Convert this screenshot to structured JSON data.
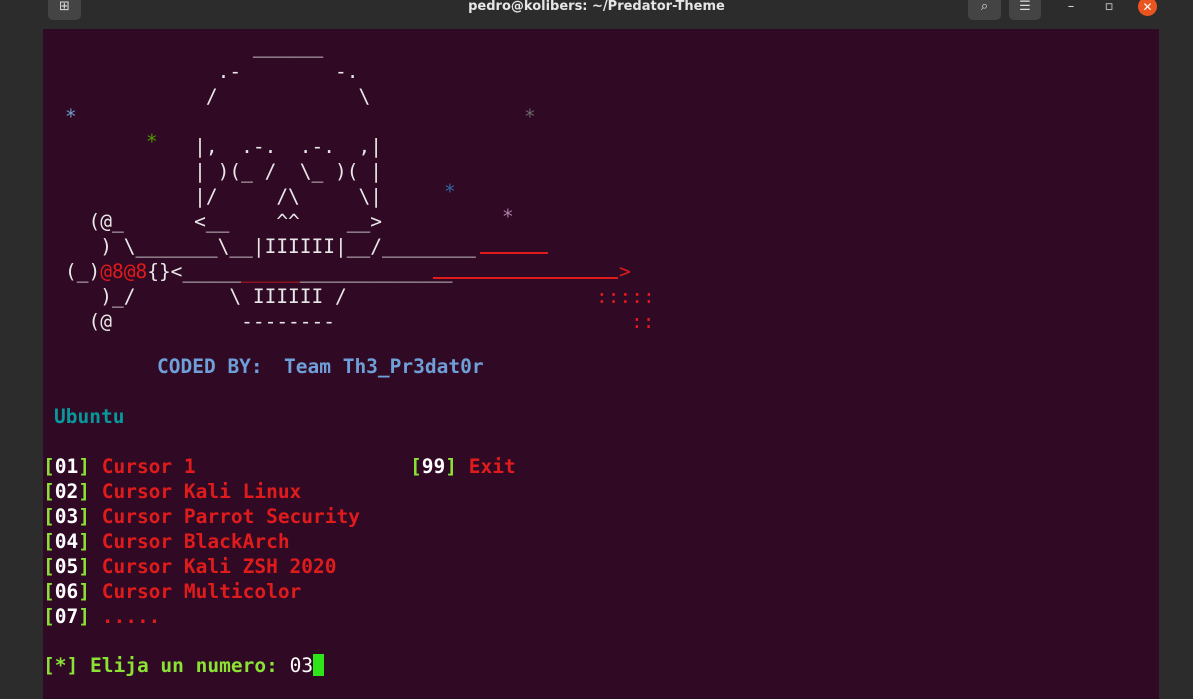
{
  "window": {
    "title": "pedro@kolibers: ~/Predator-Theme",
    "icons": {
      "new_tab": "new-tab-icon",
      "search": "search-icon",
      "menu": "hamburger-menu-icon",
      "minimize": "minimize-icon",
      "maximize": "maximize-icon",
      "close": "close-icon"
    },
    "glyphs": {
      "new_tab": "⊞",
      "search": "⌕",
      "menu": "☰",
      "minimize": "–",
      "maximize": "▫",
      "close": "✕"
    }
  },
  "banner": {
    "art_lines": [
      "                ______",
      "             .-        -.",
      "            /            \\",
      "",
      "           |,  .-.  .-.  ,|",
      "           | )(_ /  \\_ )( |",
      "           |/     /\\     \\|",
      "  (@_      <__    ^^    __>",
      "   ) \\_______\\__|IIIIII|__/________",
      "(_)",
      "   )_/        \\ IIIIII /",
      "  (@           --------"
    ],
    "skull_line_red": "@8@8",
    "skull_line_mid": "{}<",
    "skull_line_under": "_____",
    "skull_line_under2": "_____________",
    "arrow_tip": ">",
    "dots_1": ":::::",
    "dots_2": "::",
    "stars": [
      "*",
      "*",
      "*",
      "*",
      "*"
    ],
    "star_colors": [
      "#729fcf",
      "#4e9a06",
      "#6a6a6a",
      "#3465a4",
      "#ad7fa8"
    ],
    "coded_by_label": "CODED BY:",
    "coded_by_team": "Team Th3_Pr3dat0r"
  },
  "os_label": "Ubuntu",
  "menu": {
    "items": [
      {
        "num": "01",
        "label": "Cursor 1"
      },
      {
        "num": "02",
        "label": "Cursor Kali Linux"
      },
      {
        "num": "03",
        "label": "Cursor Parrot Security"
      },
      {
        "num": "04",
        "label": "Cursor BlackArch"
      },
      {
        "num": "05",
        "label": "Cursor Kali ZSH 2020"
      },
      {
        "num": "06",
        "label": "Cursor Multicolor"
      },
      {
        "num": "07",
        "label": "....."
      }
    ],
    "exit": {
      "num": "99",
      "label": "Exit"
    }
  },
  "prompt": {
    "marker": "[*]",
    "text": "Elija un numero:",
    "input": "03"
  },
  "colors": {
    "terminal_bg": "#300a24",
    "titlebar_bg": "#2c2c2c",
    "accent_red": "#e01b1b",
    "accent_green": "#8ae234",
    "coded_by": "#6f9fd8",
    "ubuntu": "#06989a",
    "cursor": "#2ee51a",
    "close_button": "#e95420"
  }
}
